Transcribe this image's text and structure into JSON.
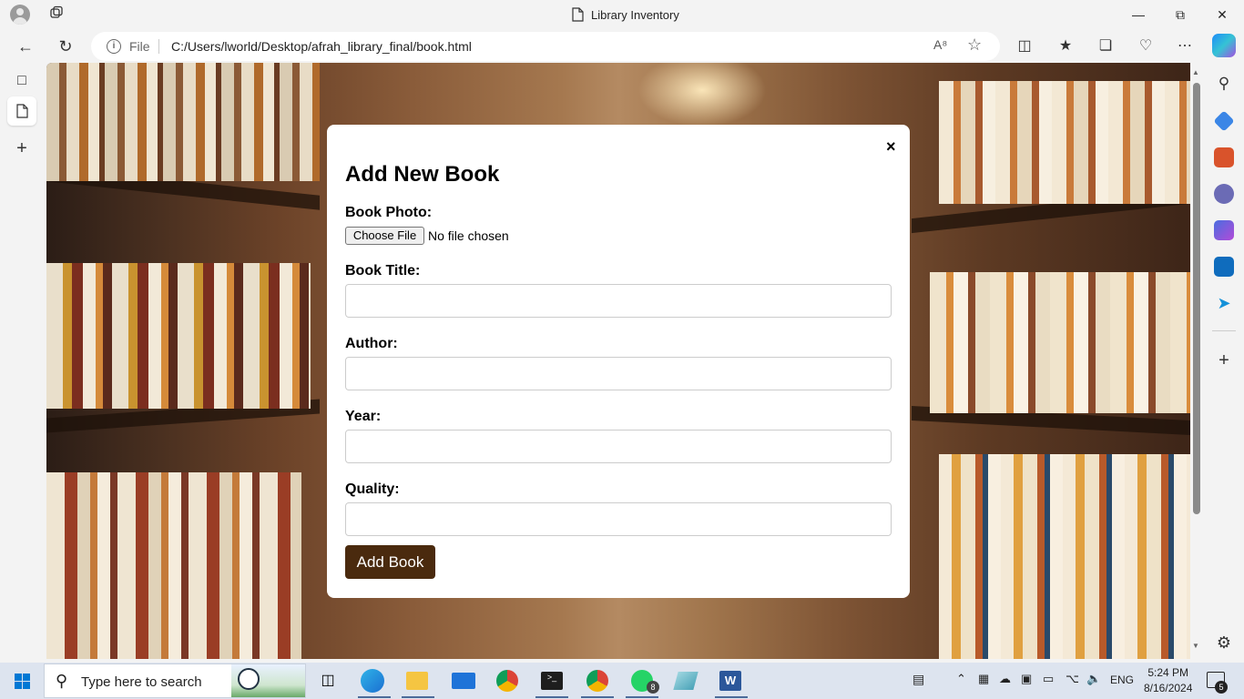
{
  "window": {
    "title": "Library Inventory"
  },
  "address_bar": {
    "scheme_label": "File",
    "url": "C:/Users/lworld/Desktop/afrah_library_final/book.html"
  },
  "modal": {
    "close_glyph": "×",
    "heading": "Add New Book",
    "photo_label": "Book Photo:",
    "file_button": "Choose File",
    "file_status": "No file chosen",
    "title_label": "Book Title:",
    "title_value": "",
    "author_label": "Author:",
    "author_value": "",
    "year_label": "Year:",
    "year_value": "",
    "quality_label": "Quality:",
    "quality_value": "",
    "submit_label": "Add Book",
    "submit_color": "#4a2a0e"
  },
  "taskbar": {
    "search_placeholder": "Type here to search",
    "language": "ENG",
    "time": "5:24 PM",
    "date": "8/16/2024",
    "whatsapp_badge": "8",
    "notification_count": "5"
  },
  "colors": {
    "accent": "#0078d4",
    "modal_bg": "#ffffff"
  }
}
